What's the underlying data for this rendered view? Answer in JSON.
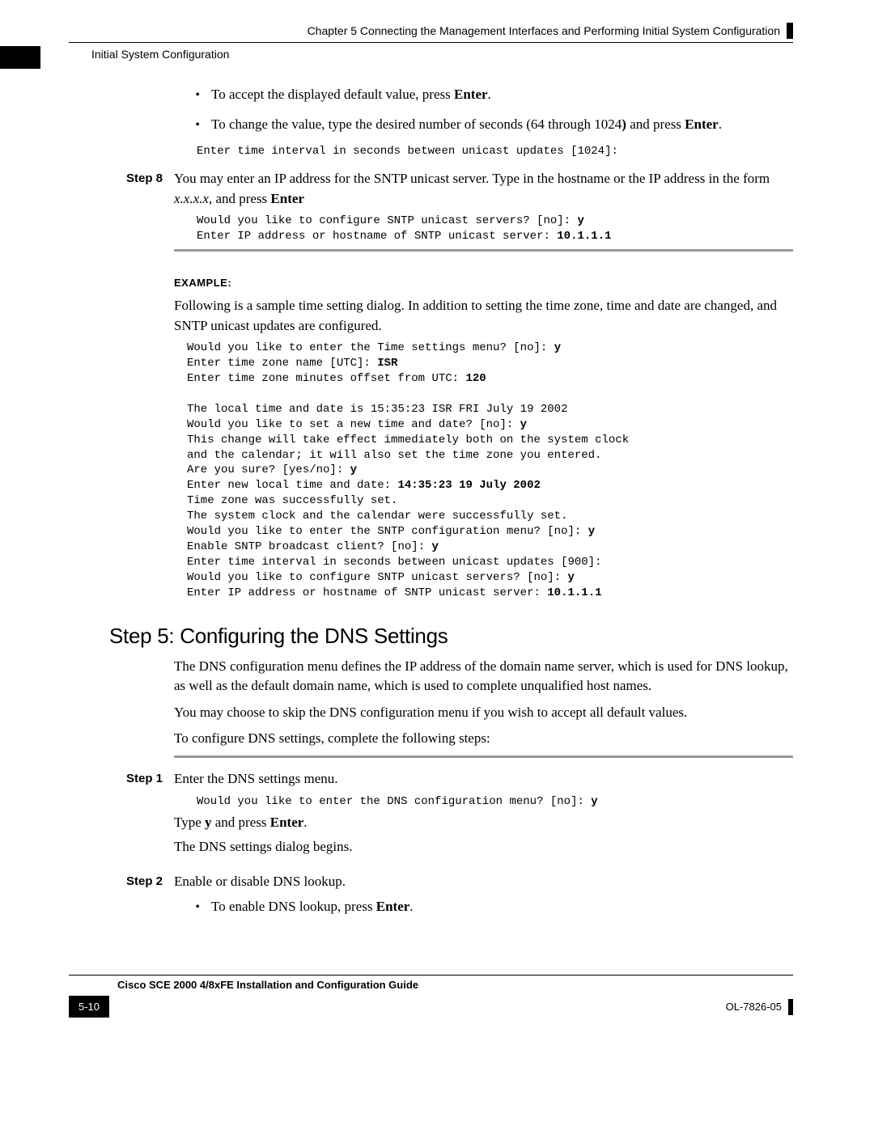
{
  "header": {
    "chapterLine": "Chapter 5      Connecting the Management Interfaces and Performing Initial System Configuration",
    "running": "Initial System Configuration"
  },
  "top": {
    "bullets": {
      "b1_pre": "To accept the displayed default value, press ",
      "b1_bold": "Enter",
      "b1_post": ".",
      "b2_pre": "To change the value, type the desired number of seconds (64 through 1024",
      "b2_bold1": ")",
      "b2_mid": " and press ",
      "b2_bold2": "Enter",
      "b2_post": "."
    },
    "mono1": "Enter time interval in seconds between unicast updates [1024]:"
  },
  "step8": {
    "label": "Step 8",
    "p_pre": "You may enter an IP address for the SNTP unicast server. Type in the hostname or the IP address in the form ",
    "p_italic": "x.x.x.x",
    "p_mid": ", and press ",
    "p_bold": "Enter",
    "mono_line1": "Would you like to configure SNTP unicast servers? [no]: ",
    "mono_bold1": "y",
    "mono_line2": "Enter IP address or hostname of SNTP unicast server: ",
    "mono_bold2": "10.1.1.1"
  },
  "example": {
    "label": "EXAMPLE:",
    "intro": "Following is a sample time setting dialog. In addition to setting the time zone, time and date are changed, and SNTP unicast updates are configured.",
    "block": {
      "l1": "Would you like to enter the Time settings menu? [no]: ",
      "l1b": "y",
      "l2": "Enter time zone name [UTC]: ",
      "l2b": "ISR",
      "l3": "Enter time zone minutes offset from UTC: ",
      "l3b": "120",
      "blank1": "",
      "l4": "The local time and date is 15:35:23 ISR FRI July 19 2002",
      "l5": "Would you like to set a new time and date? [no]: ",
      "l5b": "y",
      "l6": "This change will take effect immediately both on the system clock",
      "l7": "and the calendar; it will also set the time zone you entered.",
      "l8": "Are you sure? [yes/no]: ",
      "l8b": "y",
      "l9": "Enter new local time and date: ",
      "l9b": "14:35:23 19 July 2002",
      "l10": "Time zone was successfully set.",
      "l11": "The system clock and the calendar were successfully set.",
      "l12": "Would you like to enter the SNTP configuration menu? [no]: ",
      "l12b": "y",
      "l13": "Enable SNTP broadcast client? [no]: ",
      "l13b": "y",
      "l14": "Enter time interval in seconds between unicast updates [900]:",
      "l15": "Would you like to configure SNTP unicast servers? [no]: ",
      "l15b": "y",
      "l16": "Enter IP address or hostname of SNTP unicast server: ",
      "l16b": "10.1.1.1"
    }
  },
  "dns": {
    "heading": "Step 5: Configuring the DNS Settings",
    "p1": "The DNS configuration menu defines the IP address of the domain name server, which is used for DNS lookup, as well as the default domain name, which is used to complete unqualified host names.",
    "p2": "You may choose to skip the DNS configuration menu if you wish to accept all default values.",
    "p3": "To configure DNS settings, complete the following steps:",
    "step1": {
      "label": "Step 1",
      "p1": "Enter the DNS settings menu.",
      "mono": "Would you like to enter the DNS configuration menu? [no]: ",
      "monob": "y",
      "p2_pre": "Type ",
      "p2_b1": "y",
      "p2_mid": " and press ",
      "p2_b2": "Enter",
      "p2_post": ".",
      "p3": "The DNS settings dialog begins."
    },
    "step2": {
      "label": "Step 2",
      "p1": "Enable or disable DNS lookup.",
      "bullet_pre": "To enable DNS lookup, press ",
      "bullet_b": "Enter",
      "bullet_post": "."
    }
  },
  "footer": {
    "bookTitle": "Cisco SCE 2000 4/8xFE Installation and Configuration Guide",
    "pageNum": "5-10",
    "docNum": "OL-7826-05"
  }
}
